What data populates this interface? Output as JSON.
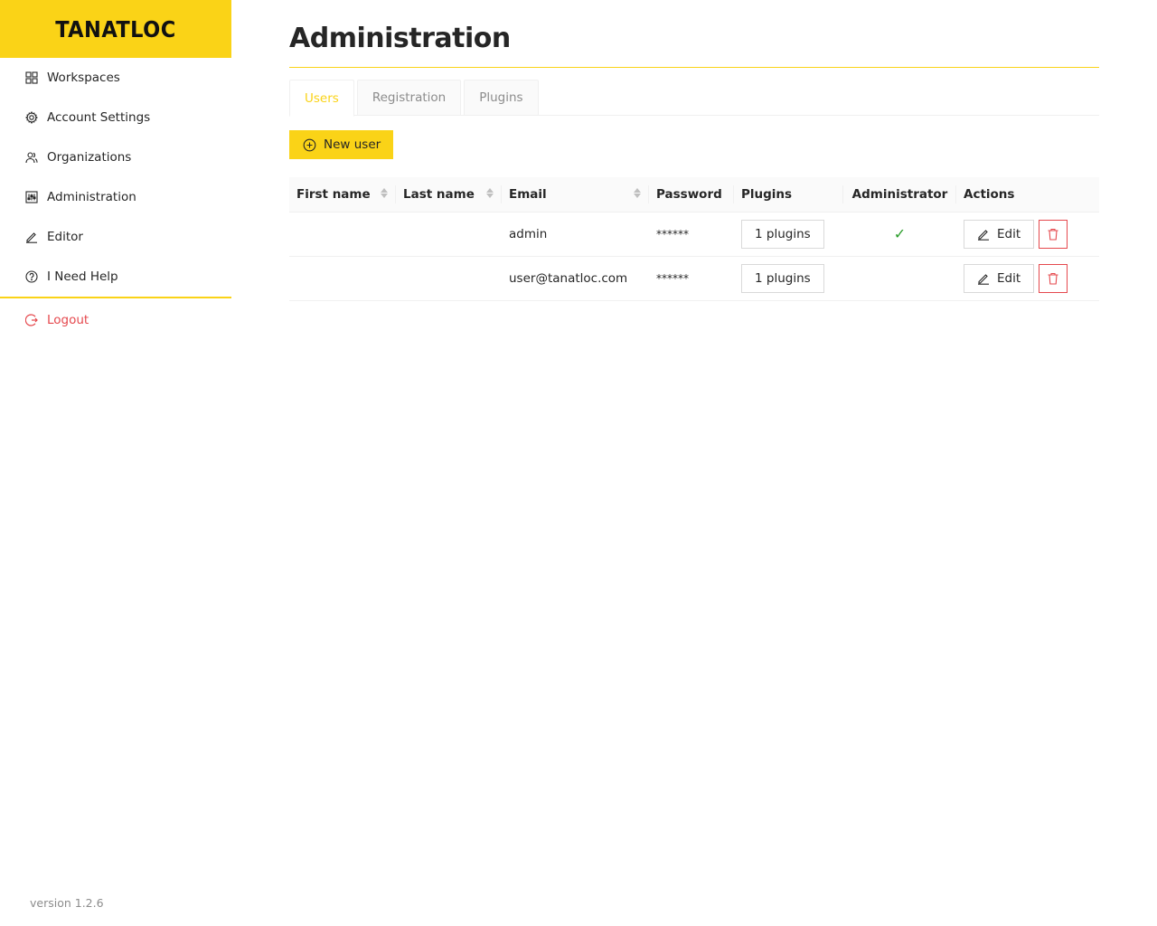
{
  "brand": {
    "logo_text": "TANATLOC",
    "logo_color": "#fad317"
  },
  "sidebar": {
    "items": [
      {
        "label": "Workspaces",
        "icon": "grid-icon"
      },
      {
        "label": "Account Settings",
        "icon": "gear-icon"
      },
      {
        "label": "Organizations",
        "icon": "users-icon"
      },
      {
        "label": "Administration",
        "icon": "sliders-icon"
      },
      {
        "label": "Editor",
        "icon": "pencil-icon"
      },
      {
        "label": "I Need Help",
        "icon": "help-icon"
      }
    ],
    "logout_label": "Logout",
    "version": "version 1.2.6"
  },
  "page": {
    "title": "Administration",
    "tabs": [
      {
        "label": "Users",
        "active": true
      },
      {
        "label": "Registration",
        "active": false
      },
      {
        "label": "Plugins",
        "active": false
      }
    ],
    "new_user_label": "New user"
  },
  "table": {
    "columns": [
      "First name",
      "Last name",
      "Email",
      "Password",
      "Plugins",
      "Administrator",
      "Actions"
    ],
    "rows": [
      {
        "first_name": "",
        "last_name": "",
        "email": "admin",
        "password": "******",
        "plugins": "1 plugins",
        "administrator": "✓",
        "edit_label": "Edit"
      },
      {
        "first_name": "",
        "last_name": "",
        "email": "user@tanatloc.com",
        "password": "******",
        "plugins": "1 plugins",
        "administrator": "",
        "edit_label": "Edit"
      }
    ]
  },
  "colors": {
    "accent": "#fad317",
    "danger": "#e5484d",
    "success": "#2a9d2a"
  }
}
